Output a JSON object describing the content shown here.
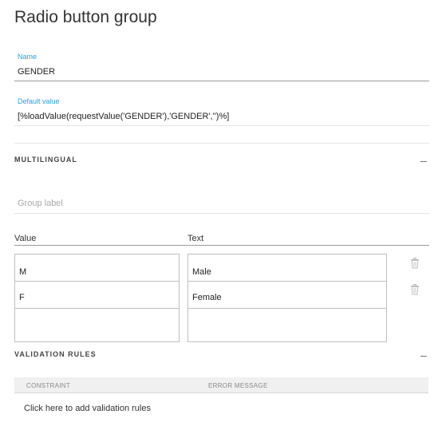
{
  "page": {
    "title": "Radio button group"
  },
  "form": {
    "name_label": "Name",
    "name_value": "GENDER",
    "default_label": "Default value",
    "default_value": "[%loadValue(requestValue('GENDER'),'GENDER','')%]"
  },
  "multilingual": {
    "title": "MULTILINGUAL",
    "toggle": "–",
    "group_label_placeholder": "Group label"
  },
  "options_table": {
    "value_header": "Value",
    "text_header": "Text",
    "rows": [
      {
        "value": "M",
        "text": "Male"
      },
      {
        "value": "F",
        "text": "Female"
      },
      {
        "value": "",
        "text": ""
      }
    ]
  },
  "validation": {
    "title": "VALIDATION RULES",
    "toggle": "–",
    "col_constraint": "CONSTRAINT",
    "col_error": "ERROR MESSAGE",
    "add_link": "Click here to add validation rules"
  },
  "icons": {
    "delete": "trash-icon"
  }
}
